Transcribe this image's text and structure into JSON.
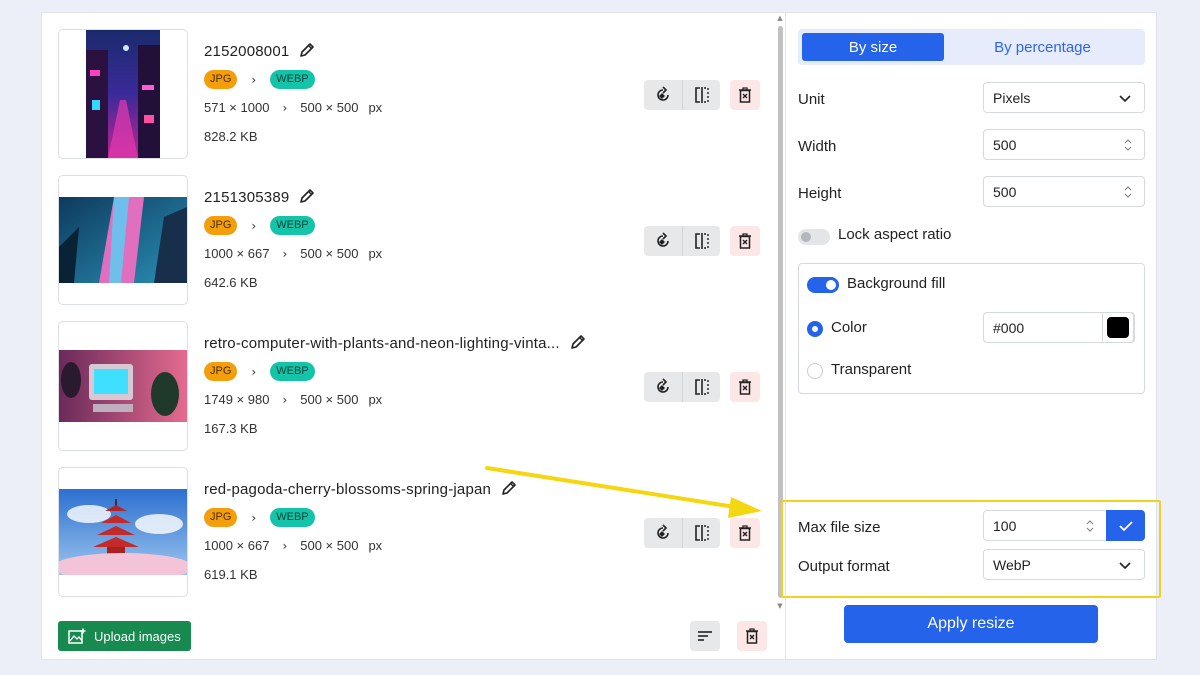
{
  "images": [
    {
      "name": "2152008001",
      "from_format": "JPG",
      "to_format": "WEBP",
      "original_dims": "571 × 1000",
      "target_dims": "500 × 500",
      "unit": "px",
      "file_size": "828.2 KB"
    },
    {
      "name": "2151305389",
      "from_format": "JPG",
      "to_format": "WEBP",
      "original_dims": "1000 × 667",
      "target_dims": "500 × 500",
      "unit": "px",
      "file_size": "642.6 KB"
    },
    {
      "name": "retro-computer-with-plants-and-neon-lighting-vinta...",
      "from_format": "JPG",
      "to_format": "WEBP",
      "original_dims": "1749 × 980",
      "target_dims": "500 × 500",
      "unit": "px",
      "file_size": "167.3 KB"
    },
    {
      "name": "red-pagoda-cherry-blossoms-spring-japan",
      "from_format": "JPG",
      "to_format": "WEBP",
      "original_dims": "1000 × 667",
      "target_dims": "500 × 500",
      "unit": "px",
      "file_size": "619.1 KB"
    }
  ],
  "left_footer": {
    "upload_label": "Upload images"
  },
  "settings": {
    "tabs": {
      "by_size": "By size",
      "by_percentage": "By percentage"
    },
    "unit_label": "Unit",
    "unit_value": "Pixels",
    "width_label": "Width",
    "width_value": "500",
    "height_label": "Height",
    "height_value": "500",
    "lock_aspect_label": "Lock aspect ratio",
    "background_fill_label": "Background fill",
    "color_label": "Color",
    "color_value": "#000",
    "transparent_label": "Transparent",
    "max_file_size_label": "Max file size",
    "max_file_size_value": "100",
    "output_format_label": "Output format",
    "output_format_value": "WebP",
    "apply_label": "Apply resize"
  },
  "colors": {
    "accent": "#2563eb",
    "upload": "#178a4f",
    "jpg_badge": "#f59e0b",
    "webp_badge": "#14c4a8",
    "highlight": "#f2d31b"
  }
}
